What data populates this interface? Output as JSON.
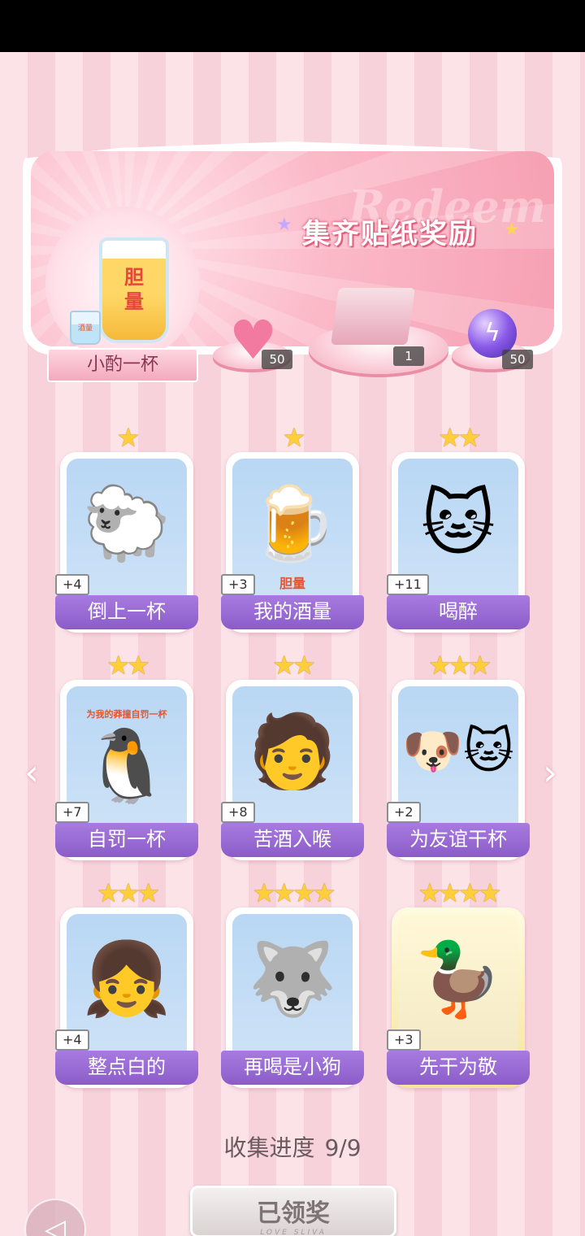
{
  "banner": {
    "title": "集齐贴纸奖励",
    "bg_word": "Redeem",
    "main_reward": {
      "label": "小酌一杯",
      "glass_text": "胆量",
      "cup_text": "酒量"
    },
    "rewards": [
      {
        "icon": "pink-heart-gem-icon",
        "count": "50"
      },
      {
        "icon": "sticker-pack-box-icon",
        "count": "1"
      },
      {
        "icon": "purple-energy-orb-icon",
        "count": "50"
      }
    ]
  },
  "cards": [
    {
      "name": "倒上一杯",
      "plus": "+4",
      "stars": "★",
      "icon": "sheep-pouring-beer"
    },
    {
      "name": "我的酒量",
      "plus": "+3",
      "stars": "★",
      "icon": "beer-glass",
      "art_text": "胆量"
    },
    {
      "name": "喝醉",
      "plus": "+11",
      "stars": "★★",
      "icon": "drunk-cat"
    },
    {
      "name": "自罚一杯",
      "plus": "+7",
      "stars": "★★",
      "icon": "penguin-drink",
      "art_text": "为我的莽撞自罚一杯"
    },
    {
      "name": "苦酒入喉",
      "plus": "+8",
      "stars": "★★",
      "icon": "boy-with-beer"
    },
    {
      "name": "为友谊干杯",
      "plus": "+2",
      "stars": "★★★",
      "icon": "dog-cat-cheers"
    },
    {
      "name": "整点白的",
      "plus": "+4",
      "stars": "★★★",
      "icon": "girl-with-bottle"
    },
    {
      "name": "再喝是小狗",
      "plus": "",
      "stars": "★★★★",
      "icon": "husky-with-beer"
    },
    {
      "name": "先干为敬",
      "plus": "+3",
      "stars": "★★★★",
      "icon": "duck-with-beer"
    }
  ],
  "progress": {
    "label": "收集进度",
    "value": "9/9"
  },
  "claim_button": {
    "label": "已领奖",
    "sub": "LOVE SLIVA"
  }
}
